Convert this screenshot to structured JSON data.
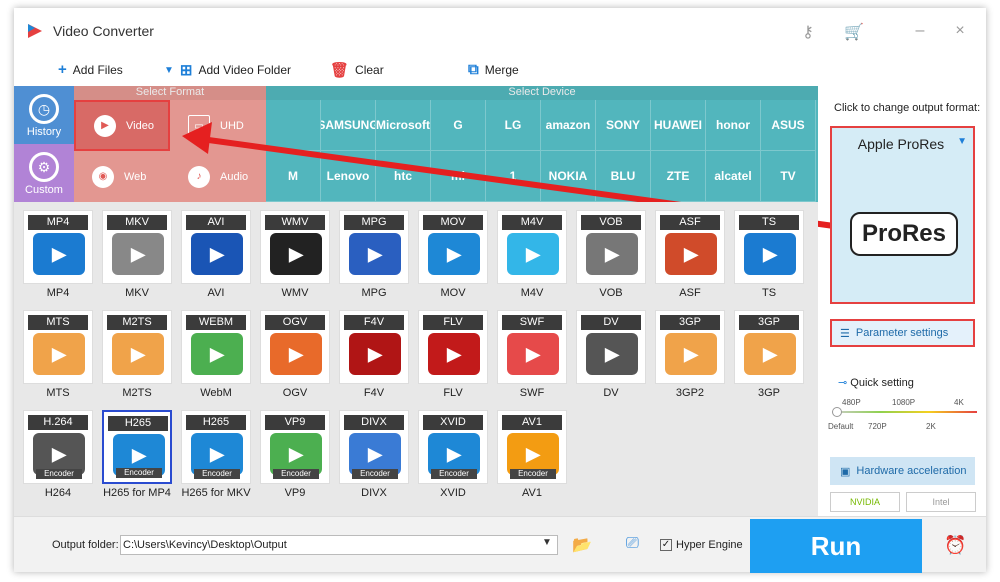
{
  "window": {
    "title": "Video Converter",
    "key_icon": "key-icon",
    "cart_icon": "cart-icon",
    "minimize": "–",
    "close": "×"
  },
  "toolbar": {
    "add_files": "Add Files",
    "add_folder": "Add Video Folder",
    "clear": "Clear",
    "merge": "Merge"
  },
  "nav": {
    "history": "History",
    "custom": "Custom"
  },
  "select_format": {
    "label": "Select Format",
    "buttons": [
      "Video",
      "UHD",
      "Web",
      "Audio"
    ]
  },
  "select_device": {
    "label": "Select Device",
    "row1": [
      "",
      "SAMSUNG",
      "Microsoft",
      "G",
      "LG",
      "amazon",
      "SONY",
      "HUAWEI",
      "honor",
      "ASUS"
    ],
    "row2": [
      "M",
      "Lenovo",
      "htc",
      "mi",
      "1",
      "NOKIA",
      "BLU",
      "ZTE",
      "alcatel",
      "TV"
    ]
  },
  "formats": [
    {
      "tag": "MP4",
      "label": "MP4",
      "color": "#1b7bd1"
    },
    {
      "tag": "MKV",
      "label": "MKV",
      "color": "#888888"
    },
    {
      "tag": "AVI",
      "label": "AVI",
      "color": "#1a55b5"
    },
    {
      "tag": "WMV",
      "label": "WMV",
      "color": "#222222"
    },
    {
      "tag": "MPG",
      "label": "MPG",
      "color": "#2a5fc0"
    },
    {
      "tag": "MOV",
      "label": "MOV",
      "color": "#1e88d6"
    },
    {
      "tag": "M4V",
      "label": "M4V",
      "color": "#33b6e8"
    },
    {
      "tag": "VOB",
      "label": "VOB",
      "color": "#777777"
    },
    {
      "tag": "ASF",
      "label": "ASF",
      "color": "#d04b2a"
    },
    {
      "tag": "TS",
      "label": "TS",
      "color": "#1b7bd1"
    },
    {
      "tag": "MTS",
      "label": "MTS",
      "color": "#f0a34a"
    },
    {
      "tag": "M2TS",
      "label": "M2TS",
      "color": "#f0a34a"
    },
    {
      "tag": "WEBM",
      "label": "WebM",
      "color": "#4caf50"
    },
    {
      "tag": "OGV",
      "label": "OGV",
      "color": "#e86a2a"
    },
    {
      "tag": "F4V",
      "label": "F4V",
      "color": "#b01515"
    },
    {
      "tag": "FLV",
      "label": "FLV",
      "color": "#c21a1a"
    },
    {
      "tag": "SWF",
      "label": "SWF",
      "color": "#e64a4a"
    },
    {
      "tag": "DV",
      "label": "DV",
      "color": "#555555"
    },
    {
      "tag": "3GP",
      "label": "3GP2",
      "color": "#f0a34a"
    },
    {
      "tag": "3GP",
      "label": "3GP",
      "color": "#f0a34a"
    },
    {
      "tag": "H.264",
      "label": "H264",
      "color": "#555555",
      "enc": "Encoder"
    },
    {
      "tag": "H265",
      "label": "H265 for MP4",
      "color": "#1e88d6",
      "enc": "Encoder"
    },
    {
      "tag": "H265",
      "label": "H265 for MKV",
      "color": "#1e88d6",
      "enc": "Encoder"
    },
    {
      "tag": "VP9",
      "label": "VP9",
      "color": "#4caf50",
      "enc": "Encoder"
    },
    {
      "tag": "DIVX",
      "label": "DIVX",
      "color": "#3a7bd5",
      "enc": "Encoder"
    },
    {
      "tag": "XVID",
      "label": "XVID",
      "color": "#1e88d6",
      "enc": "Encoder"
    },
    {
      "tag": "AV1",
      "label": "AV1",
      "color": "#f39c12",
      "enc": "Encoder"
    }
  ],
  "right": {
    "hint": "Click to change output format:",
    "output_format": "Apple ProRes",
    "annotation": "ProRes",
    "param": "Parameter settings",
    "quick": "Quick setting",
    "ticks_top": [
      "480P",
      "1080P",
      "4K"
    ],
    "ticks_bottom": [
      "Default",
      "720P",
      "2K"
    ],
    "hw": "Hardware acceleration",
    "nvidia": "NVIDIA",
    "intel": "Intel"
  },
  "bottom": {
    "output_label": "Output folder:",
    "output_path": "C:\\Users\\Kevincy\\Desktop\\Output",
    "hyper": "Hyper Engine",
    "run": "Run"
  }
}
